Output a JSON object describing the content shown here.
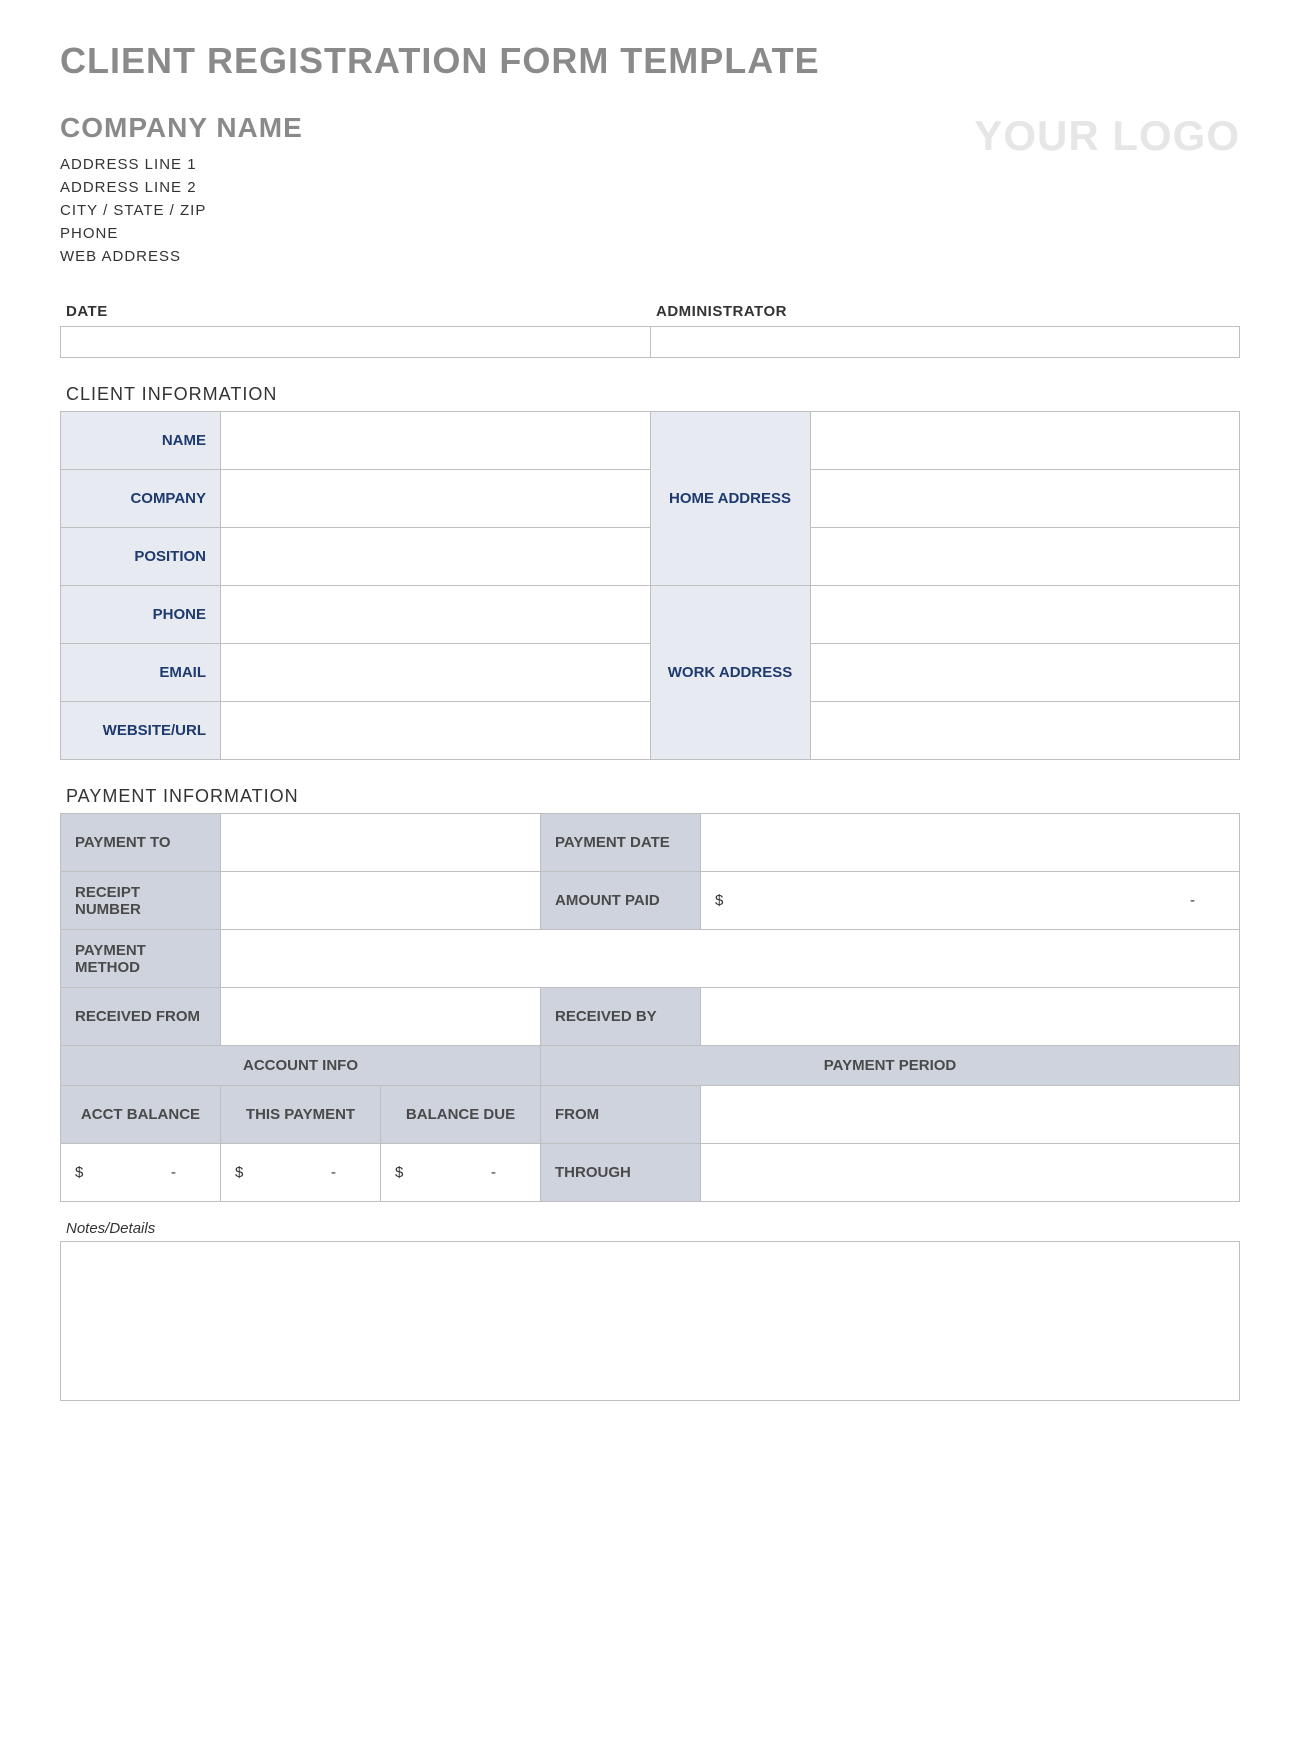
{
  "page_title": "CLIENT REGISTRATION FORM TEMPLATE",
  "header": {
    "company_name": "COMPANY NAME",
    "logo_text": "YOUR LOGO",
    "address_line_1": "ADDRESS LINE 1",
    "address_line_2": "ADDRESS LINE 2",
    "city_state_zip": "CITY / STATE / ZIP",
    "phone": "PHONE",
    "web_address": "WEB ADDRESS"
  },
  "date_admin": {
    "date_label": "DATE",
    "date_value": "",
    "admin_label": "ADMINISTRATOR",
    "admin_value": ""
  },
  "client_info": {
    "section_title": "CLIENT INFORMATION",
    "name_label": "NAME",
    "name_value": "",
    "company_label": "COMPANY",
    "company_value": "",
    "position_label": "POSITION",
    "position_value": "",
    "phone_label": "PHONE",
    "phone_value": "",
    "email_label": "EMAIL",
    "email_value": "",
    "website_label": "WEBSITE/URL",
    "website_value": "",
    "home_address_label": "HOME ADDRESS",
    "home_addr_1": "",
    "home_addr_2": "",
    "home_addr_3": "",
    "work_address_label": "WORK ADDRESS",
    "work_addr_1": "",
    "work_addr_2": "",
    "work_addr_3": ""
  },
  "payment_info": {
    "section_title": "PAYMENT INFORMATION",
    "payment_to_label": "PAYMENT TO",
    "payment_to_value": "",
    "payment_date_label": "PAYMENT DATE",
    "payment_date_value": "",
    "receipt_number_label": "RECEIPT NUMBER",
    "receipt_number_value": "",
    "amount_paid_label": "AMOUNT PAID",
    "amount_paid_sym": "$",
    "amount_paid_value": "-",
    "payment_method_label": "PAYMENT METHOD",
    "payment_method_value": "",
    "received_from_label": "RECEIVED FROM",
    "received_from_value": "",
    "received_by_label": "RECEIVED BY",
    "received_by_value": "",
    "account_info_header": "ACCOUNT INFO",
    "payment_period_header": "PAYMENT PERIOD",
    "acct_balance_label": "ACCT BALANCE",
    "this_payment_label": "THIS PAYMENT",
    "balance_due_label": "BALANCE DUE",
    "from_label": "FROM",
    "from_value": "",
    "through_label": "THROUGH",
    "through_value": "",
    "acct_balance_sym": "$",
    "acct_balance_value": "-",
    "this_payment_sym": "$",
    "this_payment_value": "-",
    "balance_due_sym": "$",
    "balance_due_value": "-"
  },
  "notes": {
    "label": "Notes/Details",
    "value": ""
  }
}
